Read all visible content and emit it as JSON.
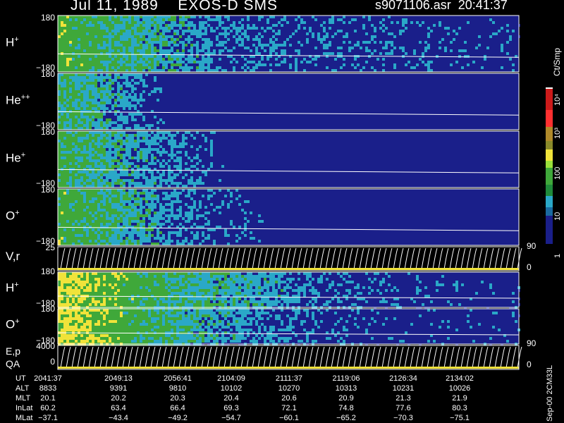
{
  "header": {
    "title_left": "Jul 11, 1989    EXOS-D SMS",
    "title_right": "s9071106.asr  20:41:37"
  },
  "colors": {
    "background": "#000000",
    "low": "#1a1f8a",
    "mid": "#2aa8c8",
    "high": "#3fa83a",
    "peak": "#f0e33a",
    "trace": "#ffffff"
  },
  "panels": [
    {
      "id": "h-plus",
      "label": "H",
      "sup": "+",
      "ymax": "180",
      "ymin": "−180"
    },
    {
      "id": "he-plus-plus",
      "label": "He",
      "sup": "++",
      "ymax": "180",
      "ymin": "−180"
    },
    {
      "id": "he-plus",
      "label": "He",
      "sup": "+",
      "ymax": "180",
      "ymin": "−180"
    },
    {
      "id": "o-plus",
      "label": "O",
      "sup": "+",
      "ymax": "180",
      "ymin": "−180"
    },
    {
      "id": "vr",
      "label": "V,r",
      "sup": "",
      "ymax": "25",
      "ymin": "",
      "rtop": "90",
      "rbot": "0"
    },
    {
      "id": "h-plus-2",
      "label": "H",
      "sup": "+",
      "ymax": "180",
      "ymin": "−180"
    },
    {
      "id": "o-plus-2",
      "label": "O",
      "sup": "+",
      "ymax": "180",
      "ymin": "−180"
    },
    {
      "id": "ep-qa",
      "label": "E,p",
      "label2": "QA",
      "sup": "",
      "ymax": "4000",
      "ymin": "0",
      "rtop": "90",
      "rbot": "0"
    }
  ],
  "colorbar": {
    "unit": "Ct/Smp",
    "ticks": [
      "10⁴",
      "10³",
      "100",
      "10",
      "1"
    ]
  },
  "footnote": "Sep-00  2CM33L",
  "annotation": {
    "row_labels": [
      "UT",
      "ALT",
      "MLT",
      "InLat",
      "MLat"
    ],
    "columns": [
      {
        "UT": "2041:37",
        "ALT": "8833",
        "MLT": "20.1",
        "InLat": "60.2",
        "MLat": "−37.1"
      },
      {
        "UT": "2049:13",
        "ALT": "9391",
        "MLT": "20.2",
        "InLat": "63.4",
        "MLat": "−43.4"
      },
      {
        "UT": "2056:41",
        "ALT": "9810",
        "MLT": "20.3",
        "InLat": "66.4",
        "MLat": "−49.2"
      },
      {
        "UT": "2104:09",
        "ALT": "10102",
        "MLT": "20.4",
        "InLat": "69.3",
        "MLat": "−54.7"
      },
      {
        "UT": "2111:37",
        "ALT": "10270",
        "MLT": "20.6",
        "InLat": "72.1",
        "MLat": "−60.1"
      },
      {
        "UT": "2119:06",
        "ALT": "10313",
        "MLT": "20.9",
        "InLat": "74.8",
        "MLat": "−65.2"
      },
      {
        "UT": "2126:34",
        "ALT": "10231",
        "MLT": "21.3",
        "InLat": "77.6",
        "MLat": "−70.3"
      },
      {
        "UT": "2134:02",
        "ALT": "10026",
        "MLT": "21.9",
        "InLat": "80.3",
        "MLat": "−75.1"
      }
    ]
  },
  "chart_data": {
    "type": "heatmap",
    "x": [
      "2041:37",
      "2049:13",
      "2056:41",
      "2104:09",
      "2111:37",
      "2119:06",
      "2126:34",
      "2134:02"
    ],
    "series": [
      {
        "name": "H+",
        "ylim": [
          -180,
          180
        ],
        "intensity_profile": [
          0.75,
          0.55,
          0.4,
          0.3,
          0.25,
          0.25,
          0.22,
          0.2
        ]
      },
      {
        "name": "He++",
        "ylim": [
          -180,
          180
        ],
        "intensity_profile": [
          0.6,
          0.4,
          0.05,
          0,
          0,
          0,
          0,
          0
        ]
      },
      {
        "name": "He+",
        "ylim": [
          -180,
          180
        ],
        "intensity_profile": [
          0.65,
          0.45,
          0.3,
          0.05,
          0,
          0,
          0,
          0
        ]
      },
      {
        "name": "O+",
        "ylim": [
          -180,
          180
        ],
        "intensity_profile": [
          0.7,
          0.5,
          0.3,
          0.2,
          0.02,
          0,
          0,
          0
        ]
      },
      {
        "name": "H+ (lower)",
        "ylim": [
          -180,
          180
        ],
        "intensity_profile": [
          0.95,
          0.7,
          0.55,
          0.45,
          0.3,
          0.25,
          0.2,
          0.2
        ]
      },
      {
        "name": "O+ (lower)",
        "ylim": [
          -180,
          180
        ],
        "intensity_profile": [
          0.95,
          0.7,
          0.5,
          0.35,
          0.25,
          0.2,
          0.2,
          0.2
        ]
      }
    ],
    "colorbar_range": [
      1,
      10000
    ],
    "colorbar_scale": "log"
  }
}
